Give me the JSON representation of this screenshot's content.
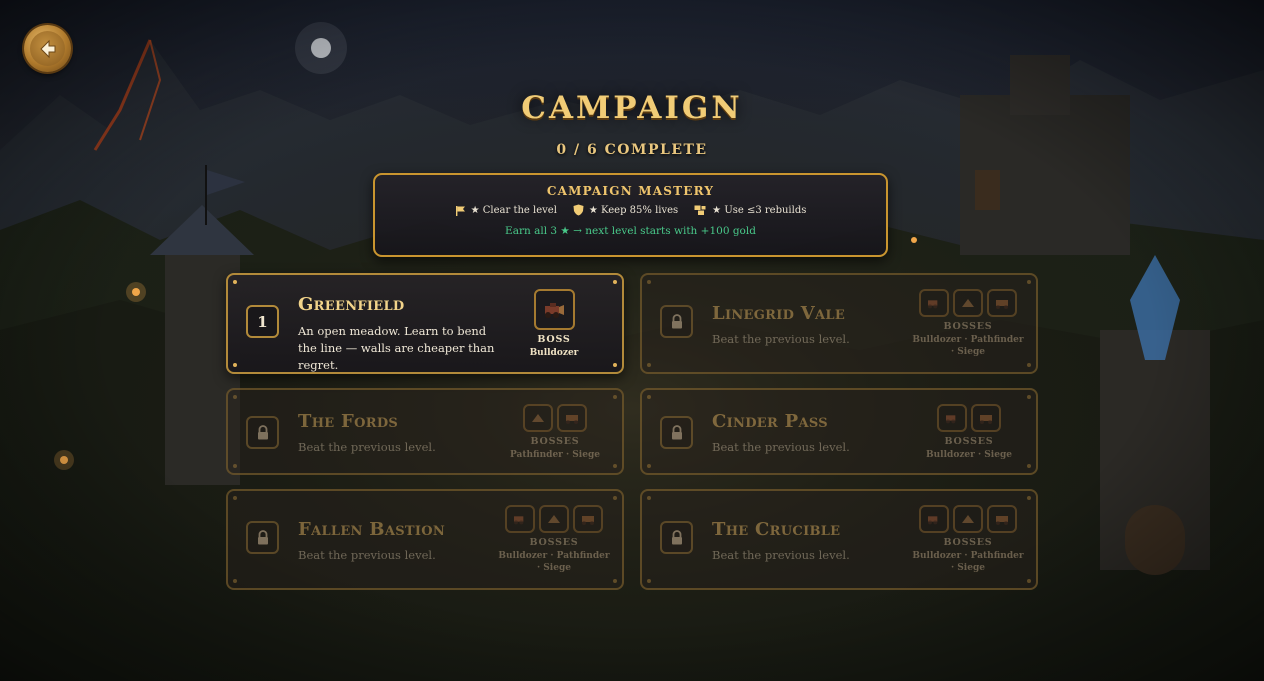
{
  "header": {
    "title": "Campaign",
    "progress": "0 / 6 complete"
  },
  "back_icon": "back-arrow-icon",
  "mastery": {
    "title": "Campaign Mastery",
    "criteria": [
      {
        "icon": "flag-icon",
        "text": "★ Clear the level"
      },
      {
        "icon": "shield-icon",
        "text": "★ Keep 85% lives"
      },
      {
        "icon": "blocks-icon",
        "text": "★ Use ≤3 rebuilds"
      }
    ],
    "bonus": "Earn all 3 ★ → next level starts with +100 gold"
  },
  "levels": [
    {
      "number": "1",
      "name": "Greenfield",
      "desc": "An open meadow. Learn to bend the line — walls are cheaper than regret.",
      "boss_label": "Boss",
      "boss_names": "Bulldozer",
      "locked": false
    },
    {
      "number": "",
      "name": "Linegrid Vale",
      "desc": "Beat the previous level.",
      "boss_label": "Bosses",
      "boss_names": "Bulldozer · Pathfinder · Siege",
      "locked": true
    },
    {
      "number": "",
      "name": "The Fords",
      "desc": "Beat the previous level.",
      "boss_label": "Bosses",
      "boss_names": "Pathfinder · Siege",
      "locked": true
    },
    {
      "number": "",
      "name": "Cinder Pass",
      "desc": "Beat the previous level.",
      "boss_label": "Bosses",
      "boss_names": "Bulldozer · Siege",
      "locked": true
    },
    {
      "number": "",
      "name": "Fallen Bastion",
      "desc": "Beat the previous level.",
      "boss_label": "Bosses",
      "boss_names": "Bulldozer · Pathfinder · Siege",
      "locked": true
    },
    {
      "number": "",
      "name": "The Crucible",
      "desc": "Beat the previous level.",
      "boss_label": "Bosses",
      "boss_names": "Bulldozer · Pathfinder · Siege",
      "locked": true
    }
  ],
  "colors": {
    "gold": "#f1cc76",
    "border": "#b28a3a",
    "bonus_green": "#49c98a",
    "panel": "#1c1a1f"
  }
}
